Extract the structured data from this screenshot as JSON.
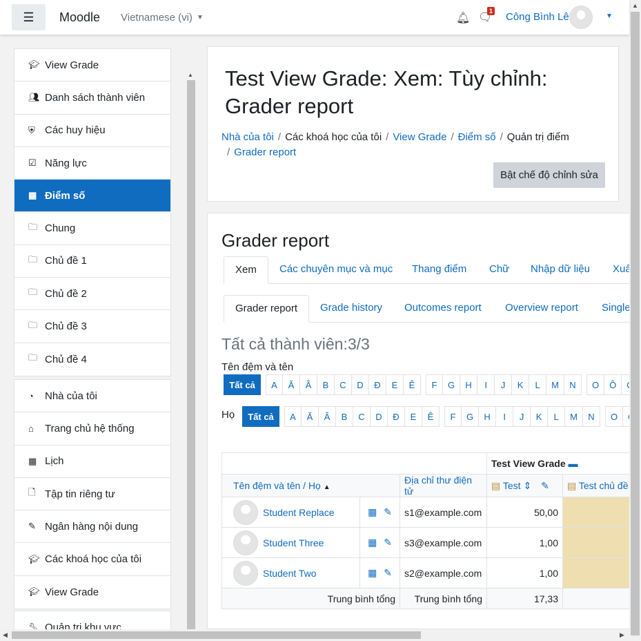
{
  "header": {
    "brand": "Moodle",
    "language": "Vietnamese (vi)",
    "notification_count": "1",
    "user_name": "Công Bình Lê"
  },
  "drawer": {
    "group1": [
      {
        "label": "View Grade",
        "icon": "graduation-cap-icon"
      },
      {
        "label": "Danh sách thành viên",
        "icon": "users-icon"
      },
      {
        "label": "Các huy hiệu",
        "icon": "shield-icon"
      },
      {
        "label": "Năng lực",
        "icon": "checkbox-icon"
      },
      {
        "label": "Điểm số",
        "icon": "table-icon",
        "active": true
      },
      {
        "label": "Chung",
        "icon": "folder-icon"
      },
      {
        "label": "Chủ đề 1",
        "icon": "folder-icon"
      },
      {
        "label": "Chủ đề 2",
        "icon": "folder-icon"
      },
      {
        "label": "Chủ đề 3",
        "icon": "folder-icon"
      },
      {
        "label": "Chủ đề 4",
        "icon": "folder-icon"
      }
    ],
    "group2": [
      {
        "label": "Nhà của tôi",
        "icon": "dashboard-icon"
      },
      {
        "label": "Trang chủ hệ thống",
        "icon": "home-icon"
      },
      {
        "label": "Lịch",
        "icon": "calendar-icon"
      },
      {
        "label": "Tập tin riêng tư",
        "icon": "file-icon"
      },
      {
        "label": "Ngân hàng nội dung",
        "icon": "brush-icon"
      },
      {
        "label": "Các khoá học của tôi",
        "icon": "graduation-cap-icon"
      },
      {
        "label": "View Grade",
        "icon": "graduation-cap-icon"
      }
    ],
    "group3": [
      {
        "label": "Quản trị khu vực",
        "icon": "wrench-icon"
      }
    ]
  },
  "page": {
    "title": "Test View Grade: Xem: Tùy chỉnh: Grader report",
    "breadcrumb": [
      "Nhà của tôi",
      "Các khoá học của tôi",
      "View Grade",
      "Điểm số",
      "Quản trị điểm",
      "Grader report"
    ],
    "edit_button": "Bật chế độ chỉnh sửa"
  },
  "report": {
    "heading": "Grader report",
    "tabs": [
      "Xem",
      "Các chuyên mục và mục",
      "Thang điểm",
      "Chữ",
      "Nhập dữ liệu",
      "Xuấ"
    ],
    "subtabs": [
      "Grader report",
      "Grade history",
      "Outcomes report",
      "Overview report",
      "Single"
    ],
    "participants": "Tất cả thành viên:3/3",
    "firstname_label": "Tên đệm và tên",
    "lastname_label": "Họ",
    "all_label": "Tất cả",
    "letters": [
      "A",
      "Ă",
      "Â",
      "B",
      "C",
      "D",
      "Đ",
      "E",
      "Ê",
      "F",
      "G",
      "H",
      "I",
      "J",
      "K",
      "L",
      "M",
      "N",
      "O",
      "Ô",
      "Ơ"
    ],
    "category": "Test View Grade",
    "col_name": "Tên đệm và tên / Họ",
    "col_email": "Địa chỉ thư điện tử",
    "col_test": "Test",
    "col_test2": "Test chủ đề",
    "students": [
      {
        "name": "Student Replace",
        "email": "s1@example.com",
        "grade": "50,00"
      },
      {
        "name": "Student Three",
        "email": "s3@example.com",
        "grade": "1,00"
      },
      {
        "name": "Student Two",
        "email": "s2@example.com",
        "grade": "1,00"
      }
    ],
    "overall_label": "Trung bình tổng",
    "overall_value": "17,33"
  }
}
